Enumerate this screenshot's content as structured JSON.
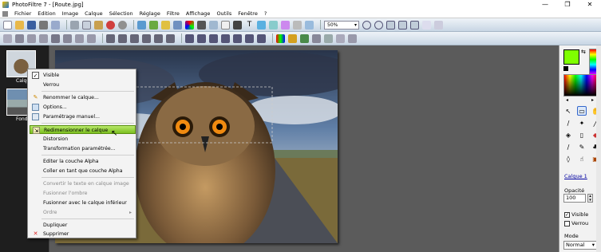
{
  "window": {
    "title": "PhotoFiltre 7 - [Route.jpg]",
    "min_glyph": "—",
    "max_glyph": "❐",
    "close_glyph": "✕"
  },
  "menu": [
    "Fichier",
    "Edition",
    "Image",
    "Calque",
    "Sélection",
    "Réglage",
    "Filtre",
    "Affichage",
    "Outils",
    "Fenêtre",
    "?"
  ],
  "toolbar": {
    "zoom_value": "50%"
  },
  "layers_strip": {
    "top_label": "Calque",
    "bottom_label": "Fond"
  },
  "context_menu": {
    "items": [
      {
        "label": "Visible",
        "icon": "check-icon",
        "state": "checked"
      },
      {
        "label": "Verrou"
      },
      {
        "label": "Renommer le calque...",
        "icon": "rename-icon"
      },
      {
        "label": "Options...",
        "icon": "options-icon"
      },
      {
        "label": "Paramétrage manuel...",
        "icon": "settings-icon"
      },
      {
        "label": "Redimensionner le calque",
        "icon": "resize-icon",
        "state": "highlighted"
      },
      {
        "label": "Distorsion"
      },
      {
        "label": "Transformation paramétrée..."
      },
      {
        "label": "Editer la couche Alpha"
      },
      {
        "label": "Coller en tant que couche Alpha"
      },
      {
        "label": "Convertir le texte en calque image",
        "state": "disabled"
      },
      {
        "label": "Fusionner l'ombre",
        "state": "disabled"
      },
      {
        "label": "Fusionner avec le calque inférieur"
      },
      {
        "label": "Ordre",
        "state": "disabled",
        "submenu": true
      },
      {
        "label": "Dupliquer"
      },
      {
        "label": "Supprimer",
        "icon": "delete-icon"
      }
    ]
  },
  "right_panel": {
    "fg_color": "#7fff00",
    "bg_color": "#000000",
    "layer_name": "Calque 1",
    "opacity_label": "Opacité",
    "opacity_value": "100",
    "visible_label": "Visible",
    "visible_checked": true,
    "lock_label": "Verrou",
    "lock_checked": false,
    "mode_label": "Mode",
    "mode_value": "Normal"
  }
}
